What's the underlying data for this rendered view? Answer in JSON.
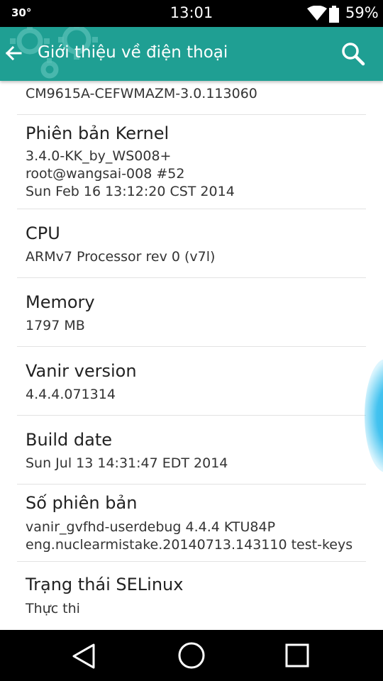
{
  "status_bar": {
    "temperature": "30°",
    "time": "13:01",
    "battery_percent": "59%"
  },
  "action_bar": {
    "title": "Giới thiệu về điện thoại",
    "accent_color": "#1f9f93"
  },
  "items": [
    {
      "title": "",
      "value": "CM9615A-CEFWMAZM-3.0.113060"
    },
    {
      "title": "Phiên bản Kernel",
      "value": "3.4.0-KK_by_WS008+\nroot@wangsai-008 #52\nSun Feb 16 13:12:20 CST 2014"
    },
    {
      "title": "CPU",
      "value": "ARMv7 Processor rev 0 (v7l)"
    },
    {
      "title": "Memory",
      "value": "1797 MB"
    },
    {
      "title": "Vanir version",
      "value": "4.4.4.071314"
    },
    {
      "title": "Build date",
      "value": "Sun Jul 13 14:31:47 EDT 2014"
    },
    {
      "title": "Số phiên bản",
      "value": "vanir_gvfhd-userdebug 4.4.4 KTU84P\neng.nuclearmistake.20140713.143110 test-keys"
    },
    {
      "title": "Trạng thái SELinux",
      "value": "Thực thi"
    }
  ],
  "icons": {
    "back": "arrow-left-icon",
    "search": "search-icon",
    "wifi": "wifi-icon",
    "battery": "battery-icon",
    "nav_back": "triangle-back-icon",
    "nav_home": "circle-home-icon",
    "nav_recent": "square-recents-icon"
  }
}
